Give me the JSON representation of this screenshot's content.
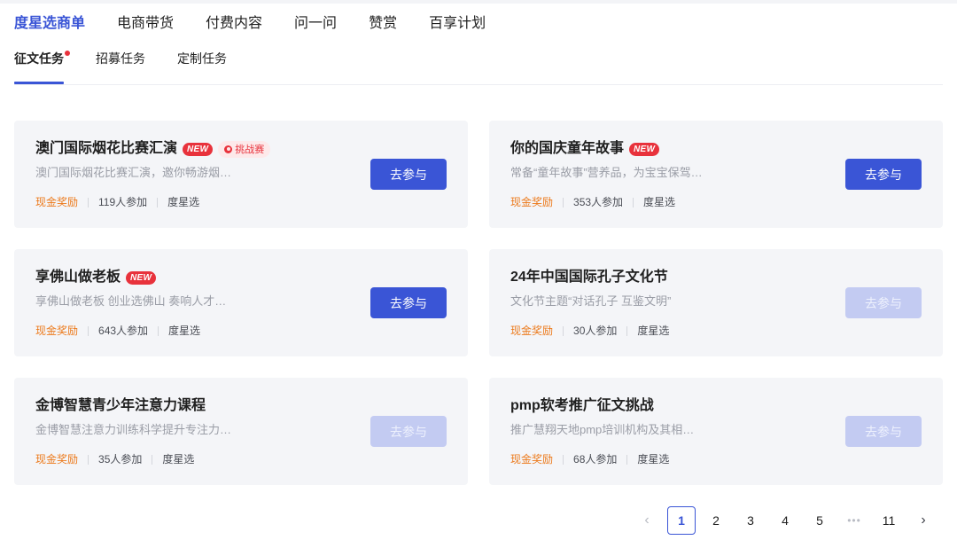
{
  "main_nav": [
    "度星选商单",
    "电商带货",
    "付费内容",
    "问一问",
    "赞赏",
    "百享计划"
  ],
  "sub_nav": [
    "征文任务",
    "招募任务",
    "定制任务"
  ],
  "cards": [
    {
      "title": "澳门国际烟花比赛汇演",
      "new_badge": "NEW",
      "challenge_badge": "挑战赛",
      "desc": "澳门国际烟花比赛汇演，邀你畅游烟…",
      "reward": "现金奖励",
      "participants": "119人参加",
      "platform": "度星选",
      "button": "去参与",
      "enabled": true
    },
    {
      "title": "你的国庆童年故事",
      "new_badge": "NEW",
      "desc": "常备“童年故事”营养品，为宝宝保驾…",
      "reward": "现金奖励",
      "participants": "353人参加",
      "platform": "度星选",
      "button": "去参与",
      "enabled": true
    },
    {
      "title": "享佛山做老板",
      "new_badge": "NEW",
      "desc": "享佛山做老板 创业选佛山 奏响人才…",
      "reward": "现金奖励",
      "participants": "643人参加",
      "platform": "度星选",
      "button": "去参与",
      "enabled": true
    },
    {
      "title": "24年中国国际孔子文化节",
      "desc": "文化节主题“对话孔子 互鉴文明”",
      "reward": "现金奖励",
      "participants": "30人参加",
      "platform": "度星选",
      "button": "去参与",
      "enabled": false
    },
    {
      "title": "金博智慧青少年注意力课程",
      "desc": "金博智慧注意力训练科学提升专注力…",
      "reward": "现金奖励",
      "participants": "35人参加",
      "platform": "度星选",
      "button": "去参与",
      "enabled": false
    },
    {
      "title": "pmp软考推广征文挑战",
      "desc": "推广慧翔天地pmp培训机构及其相…",
      "reward": "现金奖励",
      "participants": "68人参加",
      "platform": "度星选",
      "button": "去参与",
      "enabled": false
    }
  ],
  "pagination": {
    "prev": "‹",
    "pages": [
      "1",
      "2",
      "3",
      "4",
      "5"
    ],
    "current": "1",
    "ellipsis": "•••",
    "last": "11",
    "next": "›"
  },
  "colors": {
    "accent": "#3a55d6",
    "disabled_button": "#c3cbf2",
    "reward": "#ec7a1c",
    "new_badge": "#e8323c"
  }
}
